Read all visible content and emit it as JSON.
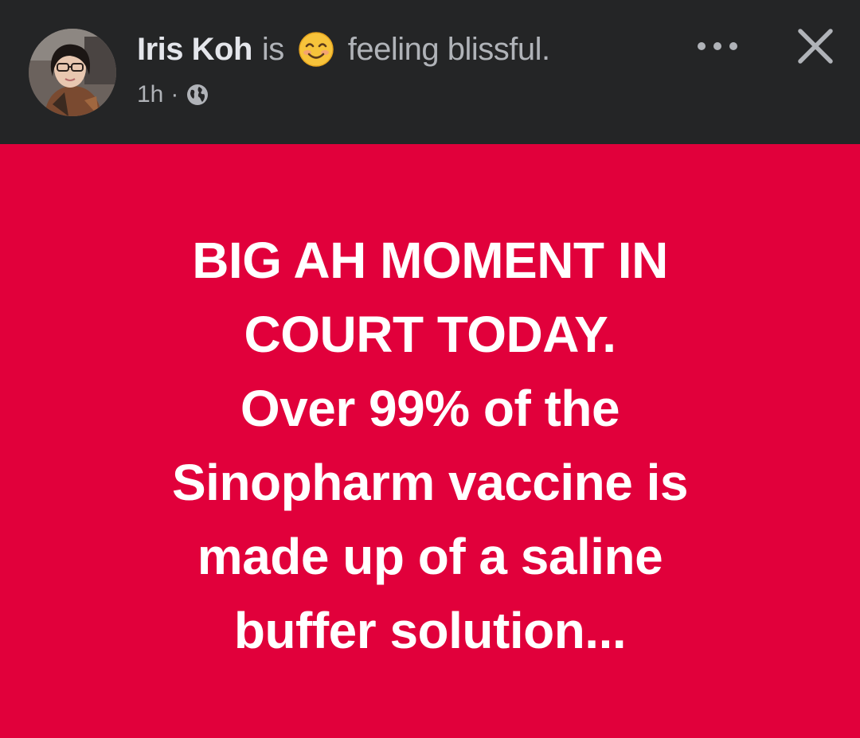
{
  "post": {
    "author": "Iris Koh",
    "verb": "is",
    "feeling_emoji": "smiling-face-emoji",
    "feeling_text": "feeling blissful.",
    "time": "1h",
    "separator": "·",
    "privacy_icon": "globe-icon",
    "more_icon": "more-options-icon",
    "close_icon": "close-icon"
  },
  "banner": {
    "background_color": "#e1003b",
    "text_color": "#ffffff",
    "lines": [
      "BIG AH MOMENT IN",
      "COURT TODAY.",
      "Over 99% of the",
      "Sinopharm vaccine is",
      "made up of a saline",
      "buffer solution..."
    ]
  },
  "colors": {
    "header_background": "#242526",
    "author_text": "#e4e6eb",
    "secondary_text": "#b0b3b8"
  }
}
